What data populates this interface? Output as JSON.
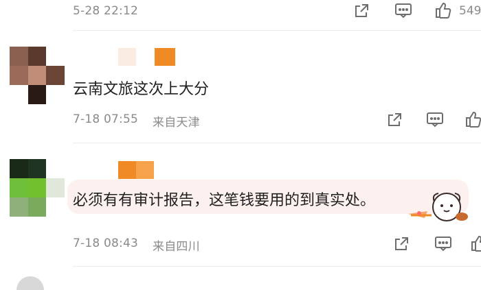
{
  "comments": [
    {
      "timestamp": "5-28 22:12",
      "like_count": "549",
      "icons": [
        "share-icon",
        "comment-icon",
        "like-icon"
      ]
    },
    {
      "text": "云南文旅这次上大分",
      "timestamp": "7-18 07:55",
      "location": "来自天津",
      "icons": [
        "share-icon",
        "comment-icon",
        "like-icon"
      ]
    },
    {
      "text": "必须有有审计报告，这笔钱要用的到真实处。",
      "timestamp": "7-18 08:43",
      "location": "来自四川",
      "icons": [
        "share-icon",
        "comment-icon",
        "like-icon"
      ]
    }
  ],
  "colors": {
    "accent": "#f08a24",
    "meta_text": "#8a8a8a",
    "bubble": "#fdf1ef"
  }
}
